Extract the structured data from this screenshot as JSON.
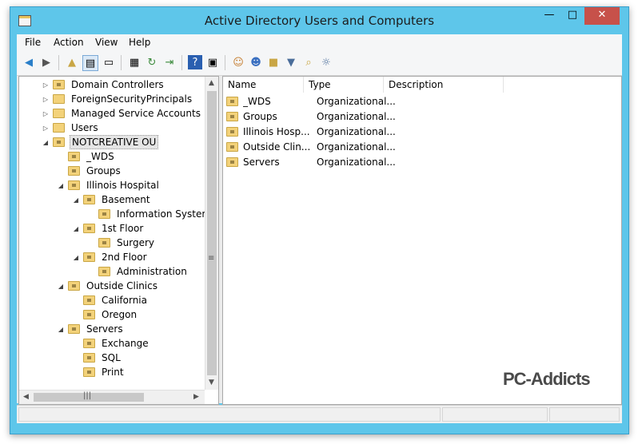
{
  "window": {
    "title": "Active Directory Users and Computers",
    "controls": {
      "minimize": "—",
      "maximize": "□",
      "close": "✕"
    }
  },
  "menu": [
    "File",
    "Action",
    "View",
    "Help"
  ],
  "toolbar": [
    "back-icon",
    "forward-icon",
    "up-folder-icon",
    "show-hide-tree-icon",
    "clipboard-icon",
    "properties-icon",
    "refresh-icon",
    "export-list-icon",
    "help-icon",
    "show-action-pane-icon",
    "new-user-icon",
    "new-group-icon",
    "new-ou-icon",
    "filter-icon",
    "find-icon",
    "add-to-group-icon"
  ],
  "tree": [
    {
      "label": "Domain Controllers",
      "expander": "▷",
      "ou": true
    },
    {
      "label": "ForeignSecurityPrincipals",
      "expander": "▷",
      "ou": false
    },
    {
      "label": "Managed Service Accounts",
      "expander": "▷",
      "ou": false
    },
    {
      "label": "Users",
      "expander": "▷",
      "ou": false
    },
    {
      "label": "NOTCREATIVE OU",
      "expander": "◢",
      "ou": true,
      "selected": true
    },
    {
      "label": "_WDS",
      "expander": "",
      "ou": true
    },
    {
      "label": "Groups",
      "expander": "",
      "ou": true
    },
    {
      "label": "Illinois Hospital",
      "expander": "◢",
      "ou": true
    },
    {
      "label": "Basement",
      "expander": "◢",
      "ou": true
    },
    {
      "label": "Information Systems",
      "expander": "",
      "ou": true
    },
    {
      "label": "1st Floor",
      "expander": "◢",
      "ou": true
    },
    {
      "label": "Surgery",
      "expander": "",
      "ou": true
    },
    {
      "label": "2nd Floor",
      "expander": "◢",
      "ou": true
    },
    {
      "label": "Administration",
      "expander": "",
      "ou": true
    },
    {
      "label": "Outside Clinics",
      "expander": "◢",
      "ou": true
    },
    {
      "label": "California",
      "expander": "",
      "ou": true
    },
    {
      "label": "Oregon",
      "expander": "",
      "ou": true
    },
    {
      "label": "Servers",
      "expander": "◢",
      "ou": true
    },
    {
      "label": "Exchange",
      "expander": "",
      "ou": true
    },
    {
      "label": "SQL",
      "expander": "",
      "ou": true
    },
    {
      "label": "Print",
      "expander": "",
      "ou": true
    }
  ],
  "list": {
    "columns": [
      "Name",
      "Type",
      "Description"
    ],
    "rows": [
      {
        "name": "_WDS",
        "type": "Organizational..."
      },
      {
        "name": "Groups",
        "type": "Organizational..."
      },
      {
        "name": "Illinois Hosp...",
        "type": "Organizational..."
      },
      {
        "name": "Outside Clin...",
        "type": "Organizational..."
      },
      {
        "name": "Servers",
        "type": "Organizational..."
      }
    ]
  },
  "scroll": {
    "up": "▲",
    "down": "▼",
    "left": "◀",
    "right": "▶",
    "vgrip": "≡",
    "hgrip": "|||"
  },
  "watermark": "PC-Addicts"
}
